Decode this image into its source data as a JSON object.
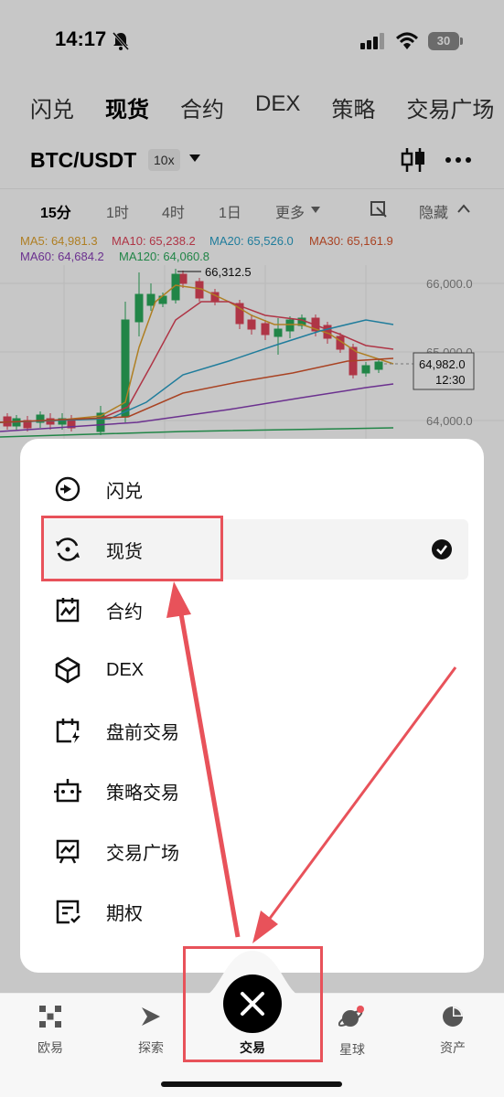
{
  "status_bar": {
    "time": "14:17",
    "battery": "30"
  },
  "top_tabs": [
    "闪兑",
    "现货",
    "合约",
    "DEX",
    "策略",
    "交易广场"
  ],
  "pair": {
    "name": "BTC/USDT",
    "leverage": "10x"
  },
  "intervals": [
    "15分",
    "1时",
    "4时",
    "1日",
    "更多"
  ],
  "hide_label": "隐藏",
  "ma_legend": {
    "ma5": "MA5: 64,981.3",
    "ma10": "MA10: 65,238.2",
    "ma20": "MA20: 65,526.0",
    "ma30": "MA30: 65,161.9",
    "ma60": "MA60: 64,684.2",
    "ma120": "MA120: 64,060.8"
  },
  "chart": {
    "high_label": "66,312.5",
    "price_levels": [
      "66,000.0",
      "65,000.0",
      "64,000.0"
    ],
    "current_price": "64,982.0",
    "countdown": "12:30"
  },
  "menu": {
    "items": [
      {
        "label": "闪兑",
        "icon": "swap-icon"
      },
      {
        "label": "现货",
        "icon": "spot-icon",
        "selected": true
      },
      {
        "label": "合约",
        "icon": "futures-icon"
      },
      {
        "label": "DEX",
        "icon": "dex-icon"
      },
      {
        "label": "盘前交易",
        "icon": "premarket-icon"
      },
      {
        "label": "策略交易",
        "icon": "bot-icon"
      },
      {
        "label": "交易广场",
        "icon": "trading-square-icon"
      },
      {
        "label": "期权",
        "icon": "options-icon"
      }
    ]
  },
  "bottom_nav": {
    "home": "欧易",
    "discover": "探索",
    "trade": "交易",
    "planet": "星球",
    "assets": "资产"
  },
  "colors": {
    "up": "#2bab5c",
    "down": "#e0445a",
    "annotation": "#e8525a"
  }
}
